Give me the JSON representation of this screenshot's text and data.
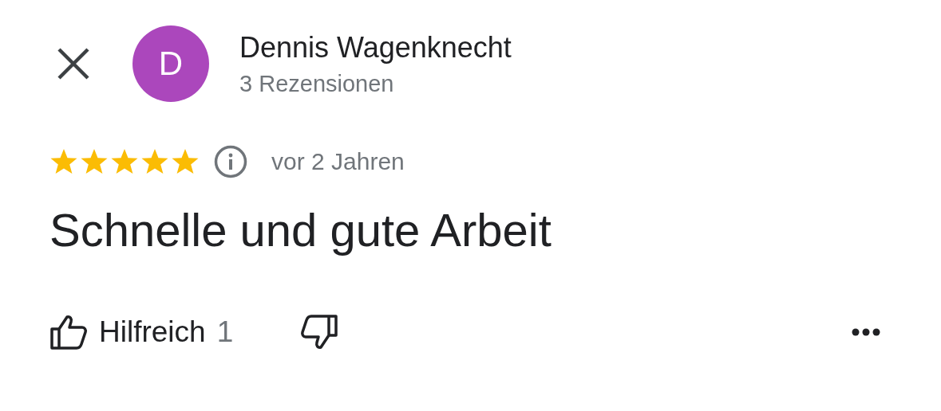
{
  "reviewer": {
    "initial": "D",
    "color": "#ab47bc",
    "name": "Dennis Wagenknecht",
    "subtitle": "3 Rezensionen"
  },
  "rating": {
    "stars": 5,
    "time": "vor 2 Jahren"
  },
  "review_text": "Schnelle und gute Arbeit",
  "actions": {
    "helpful_label": "Hilfreich",
    "helpful_count": "1"
  }
}
